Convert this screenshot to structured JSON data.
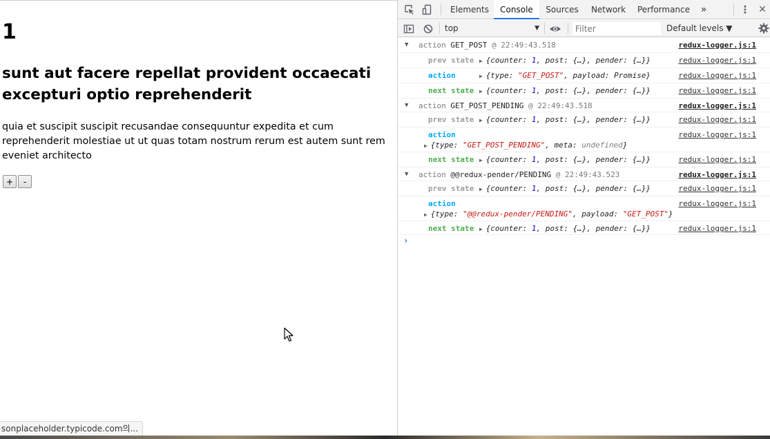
{
  "page": {
    "counter_value": "1",
    "post_title": "sunt aut facere repellat provident occaecati excepturi optio reprehenderit",
    "post_body": "quia et suscipit suscipit recusandae consequuntur expedita et cum reprehenderit molestiae ut ut quas totam nostrum rerum est autem sunt rem eveniet architecto",
    "increment_label": "+",
    "decrement_label": "-",
    "status_text": "sonplaceholder.typicode.com의..."
  },
  "devtools": {
    "tabs": [
      {
        "label": "Elements"
      },
      {
        "label": "Console"
      },
      {
        "label": "Sources"
      },
      {
        "label": "Network"
      },
      {
        "label": "Performance"
      }
    ],
    "more_tabs_glyph": "»",
    "menu_glyph": "⋮",
    "close_glyph": "✕",
    "toolbar": {
      "context": "top",
      "context_arrow": "▼",
      "filter_placeholder": "Filter",
      "levels": "Default levels ▼"
    },
    "console": {
      "source": "redux-logger.js:1",
      "prompt": "›",
      "groups": [
        {
          "label": "action",
          "type": "GET_POST",
          "time": "@ 22:49:43.518",
          "prev_label": "prev state",
          "prev_value": "{counter: 1, post: {…}, pender: {…}}",
          "action_label": "action",
          "action_value": "{type: \"GET_POST\", payload: Promise}",
          "next_label": "next state",
          "next_value": "{counter: 1, post: {…}, pender: {…}}"
        },
        {
          "label": "action",
          "type": "GET_POST_PENDING",
          "time": "@ 22:49:43.518",
          "prev_label": "prev state",
          "prev_value": "{counter: 1, post: {…}, pender: {…}}",
          "action_label": "action",
          "action_value": "{type: \"GET_POST_PENDING\", meta: undefined}",
          "next_label": "next state",
          "next_value": "{counter: 1, post: {…}, pender: {…}}"
        },
        {
          "label": "action",
          "type": "@@redux-pender/PENDING",
          "time": "@ 22:49:43.523",
          "prev_label": "prev state",
          "prev_value": "{counter: 1, post: {…}, pender: {…}}",
          "action_label": "action",
          "action_value": "{type: \"@@redux-pender/PENDING\", payload: \"GET_POST\"}",
          "next_label": "next state",
          "next_value": "{counter: 1, post: {…}, pender: {…}}"
        }
      ]
    }
  },
  "colors": {
    "accent": "#1a73e8",
    "prev_state": "#9e9e9e",
    "action": "#03a9f4",
    "next_state": "#4caf50"
  },
  "icons": [
    "inspect-element-icon",
    "device-toggle-icon",
    "sidebar-toggle-icon",
    "clear-console-icon",
    "eye-icon",
    "settings-gear-icon",
    "mouse-cursor-icon"
  ]
}
